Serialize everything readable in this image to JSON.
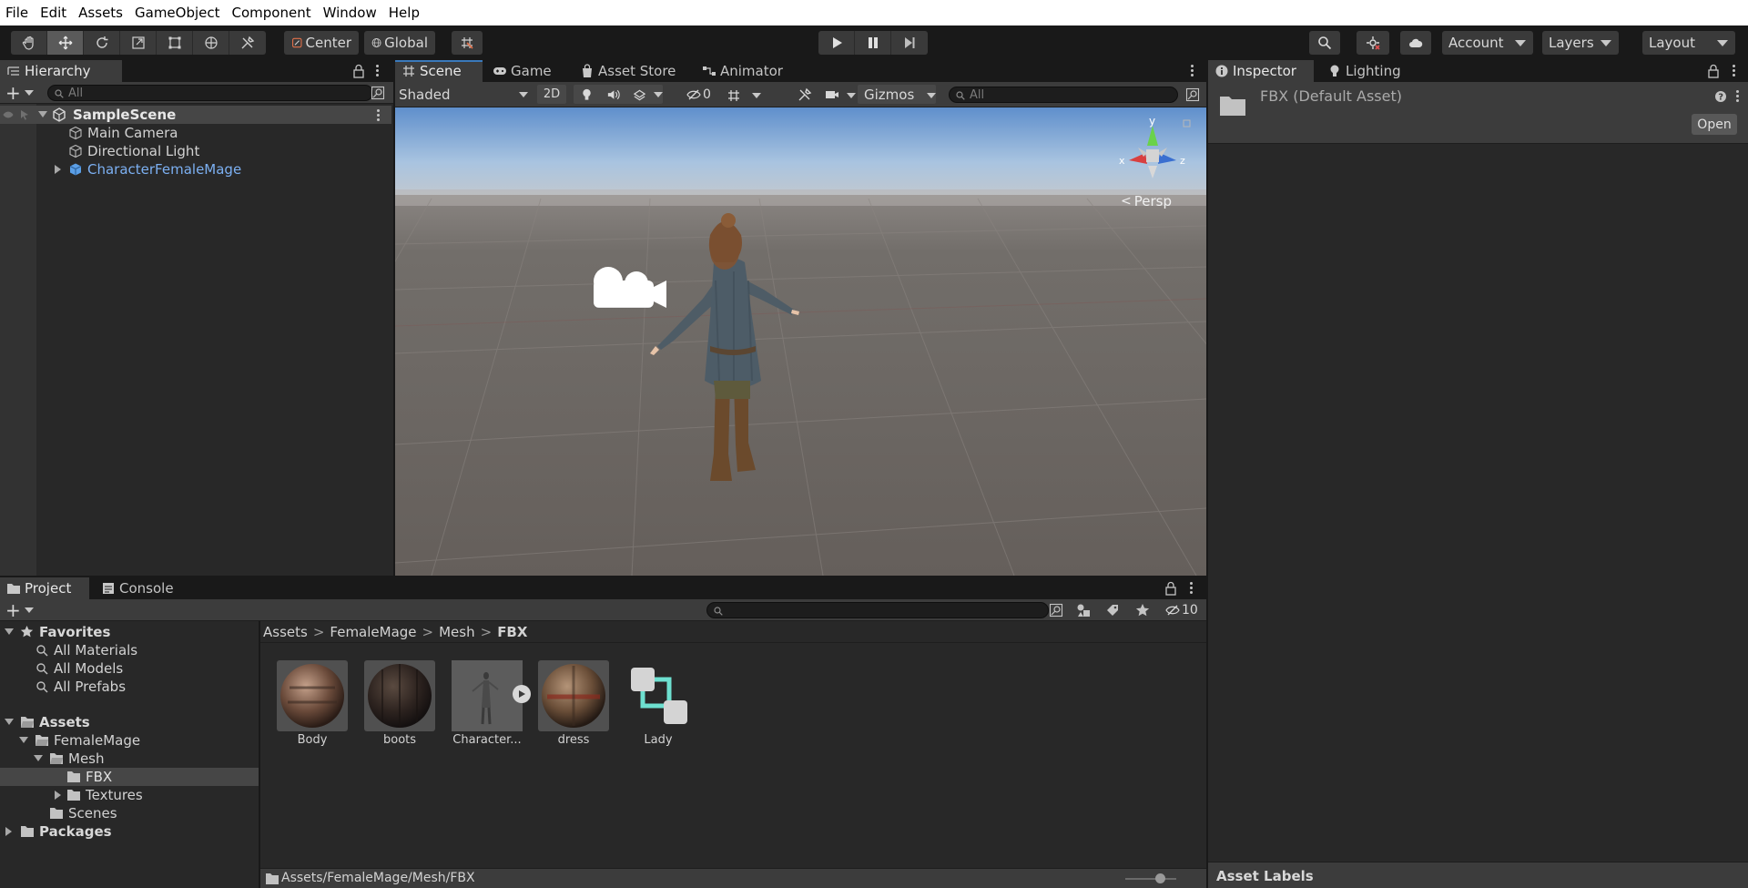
{
  "menu": [
    "File",
    "Edit",
    "Assets",
    "GameObject",
    "Component",
    "Window",
    "Help"
  ],
  "toolbar": {
    "center_label": "Center",
    "global_label": "Global",
    "account_label": "Account",
    "layers_label": "Layers",
    "layout_label": "Layout"
  },
  "hierarchy": {
    "tab_label": "Hierarchy",
    "search_placeholder": "All",
    "scene_name": "SampleScene",
    "items": [
      "Main Camera",
      "Directional Light",
      "CharacterFemaleMage"
    ]
  },
  "scene": {
    "tabs": [
      "Scene",
      "Game",
      "Asset Store",
      "Animator"
    ],
    "shading_mode": "Shaded",
    "mode_2d": "2D",
    "hidden_count": "0",
    "gizmos_label": "Gizmos",
    "search_placeholder": "All",
    "persp_label": "Persp",
    "axis_labels": {
      "y": "y",
      "x": "x",
      "z": "z"
    }
  },
  "inspector": {
    "tabs": [
      "Inspector",
      "Lighting"
    ],
    "asset_title": "FBX (Default Asset)",
    "open_label": "Open",
    "asset_labels_label": "Asset Labels"
  },
  "project": {
    "tabs": [
      "Project",
      "Console"
    ],
    "hidden_count": "10",
    "favorites_label": "Favorites",
    "favorites": [
      "All Materials",
      "All Models",
      "All Prefabs"
    ],
    "assets_label": "Assets",
    "tree": [
      "FemaleMage",
      "Mesh",
      "FBX",
      "Textures",
      "Scenes"
    ],
    "packages_label": "Packages",
    "breadcrumb": [
      "Assets",
      "FemaleMage",
      "Mesh",
      "FBX"
    ],
    "files": [
      "Body",
      "boots",
      "Character...",
      "dress",
      "Lady"
    ],
    "status_path": "Assets/FemaleMage/Mesh/FBX"
  },
  "colors": {
    "selection_blue": "#3a79bb",
    "prefab_blue": "#7cb0f2",
    "panel_bg": "#282828",
    "toolbar_bg": "#191919",
    "sky_top": "#5f8fcc",
    "ground": "#6e6a66"
  }
}
